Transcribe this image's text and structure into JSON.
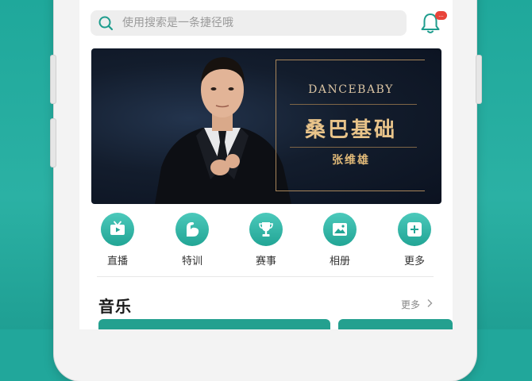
{
  "status_bar": {
    "left": "",
    "middle": "",
    "right": ""
  },
  "search": {
    "placeholder": "使用搜索是一条捷径哦"
  },
  "notifications": {
    "badge": "..."
  },
  "banner": {
    "brand": "DANCEBABY",
    "title": "桑巴基础",
    "subtitle": "张维雄"
  },
  "nav": [
    {
      "label": "直播",
      "icon": "tv-icon"
    },
    {
      "label": "特训",
      "icon": "muscle-icon"
    },
    {
      "label": "赛事",
      "icon": "trophy-icon"
    },
    {
      "label": "相册",
      "icon": "photo-album-icon"
    },
    {
      "label": "更多",
      "icon": "plus-icon"
    }
  ],
  "music_section": {
    "title": "音乐",
    "more_label": "更多"
  },
  "colors": {
    "accent": "#22a595",
    "background": "#21a79b",
    "banner_gold": "#e9c48a",
    "badge_red": "#e8443a"
  }
}
